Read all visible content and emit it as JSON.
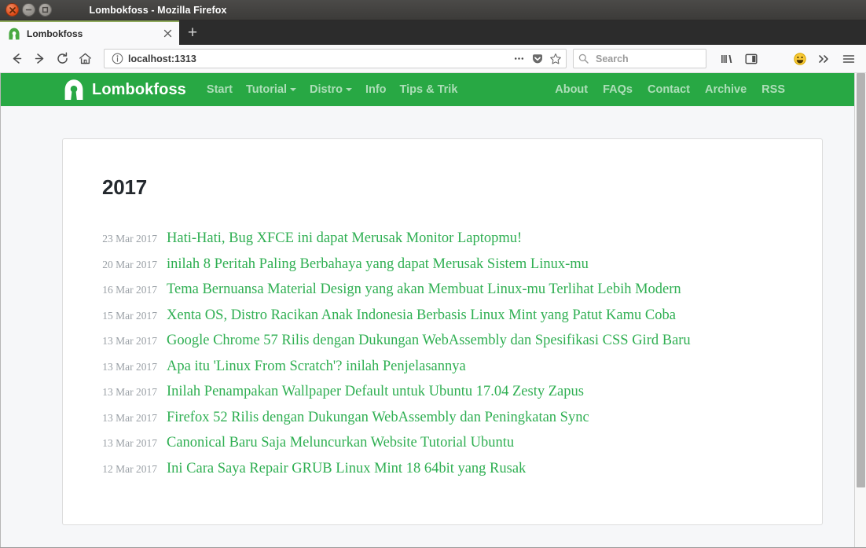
{
  "window": {
    "title": "Lombokfoss - Mozilla Firefox",
    "close_label": "✕",
    "minimize_label": "−",
    "maximize_label": "□"
  },
  "browser": {
    "tab": {
      "title": "Lombokfoss",
      "close_label": "✕",
      "favicon_name": "lombokfoss-favicon"
    },
    "new_tab_label": "+",
    "toolbar": {
      "back_label": "←",
      "forward_label": "→",
      "reload_label": "↻",
      "home_label": "⌂",
      "url_value": "localhost:1313",
      "identity_label": "ⓘ",
      "page_actions_label": "…",
      "pocket_label": "pocket",
      "bookmark_label": "☆"
    },
    "search": {
      "placeholder": "Search"
    },
    "icons": [
      {
        "name": "library-icon",
        "glyph": "|||\\"
      },
      {
        "name": "sidebar-icon",
        "glyph": "▤"
      },
      {
        "name": "sync-account-icon",
        "glyph": "◕"
      },
      {
        "name": "smiley-feedback-icon",
        "glyph": "☺"
      },
      {
        "name": "overflow-chevrons-icon",
        "glyph": "»"
      },
      {
        "name": "hamburger-menu-icon",
        "glyph": "≡"
      }
    ]
  },
  "site": {
    "brand": "Lombokfoss",
    "nav_left": [
      {
        "label": "Start",
        "has_caret": false
      },
      {
        "label": "Tutorial",
        "has_caret": true
      },
      {
        "label": "Distro",
        "has_caret": true
      },
      {
        "label": "Info",
        "has_caret": false
      },
      {
        "label": "Tips & Trik",
        "has_caret": false
      }
    ],
    "nav_right": [
      {
        "label": "About"
      },
      {
        "label": "FAQs"
      },
      {
        "label": "Contact"
      },
      {
        "label": "Archive"
      },
      {
        "label": "RSS"
      }
    ],
    "colors": {
      "navbar_green": "#28a844",
      "link_green": "#2faf52",
      "page_background": "#f6f7f9",
      "card_background": "#ffffff",
      "date_gray": "#9aa0a6",
      "heading_dark": "#24292e"
    }
  },
  "archive": {
    "year": "2017",
    "posts": [
      {
        "date": "23 Mar 2017",
        "title": "Hati-Hati, Bug XFCE ini dapat Merusak Monitor Laptopmu!"
      },
      {
        "date": "20 Mar 2017",
        "title": "inilah 8 Peritah Paling Berbahaya yang dapat Merusak Sistem Linux-mu"
      },
      {
        "date": "16 Mar 2017",
        "title": "Tema Bernuansa Material Design yang akan Membuat Linux-mu Terlihat Lebih Modern"
      },
      {
        "date": "15 Mar 2017",
        "title": "Xenta OS, Distro Racikan Anak Indonesia Berbasis Linux Mint yang Patut Kamu Coba"
      },
      {
        "date": "13 Mar 2017",
        "title": "Google Chrome 57 Rilis dengan Dukungan WebAssembly dan Spesifikasi CSS Gird Baru"
      },
      {
        "date": "13 Mar 2017",
        "title": "Apa itu 'Linux From Scratch'? inilah Penjelasannya"
      },
      {
        "date": "13 Mar 2017",
        "title": "Inilah Penampakan Wallpaper Default untuk Ubuntu 17.04 Zesty Zapus"
      },
      {
        "date": "13 Mar 2017",
        "title": "Firefox 52 Rilis dengan Dukungan WebAssembly dan Peningkatan Sync"
      },
      {
        "date": "13 Mar 2017",
        "title": "Canonical Baru Saja Meluncurkan Website Tutorial Ubuntu"
      },
      {
        "date": "12 Mar 2017",
        "title": "Ini Cara Saya Repair GRUB Linux Mint 18 64bit yang Rusak"
      }
    ]
  }
}
